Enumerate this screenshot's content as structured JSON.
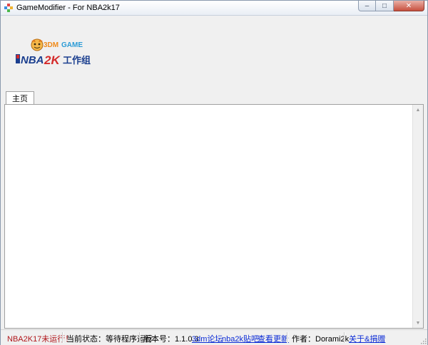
{
  "window": {
    "title": "GameModifier - For NBA2k17",
    "controls": {
      "minimize": "–",
      "maximize": "□",
      "close": "✕"
    }
  },
  "logo": {
    "top_text": "3DMGAME",
    "main_text": "NBA2K",
    "suffix_text": "工作组"
  },
  "tabs": [
    {
      "label": "主页",
      "selected": true
    }
  ],
  "status": {
    "game_status": "NBA2K17未运行！",
    "current_state": "当前状态：等待程序运行",
    "version": "版本号：1.1.0.3",
    "links": [
      "3dm论坛",
      "nba2k贴吧",
      "查看更新"
    ],
    "author": "作者：Dorami2k",
    "about_link": "关于&捐赠"
  },
  "colors": {
    "error_text": "#b0151a",
    "link": "#0b2bd6",
    "logo_orange": "#f5a623",
    "logo_blue": "#1b3f8f",
    "logo_red": "#d42a2a"
  }
}
